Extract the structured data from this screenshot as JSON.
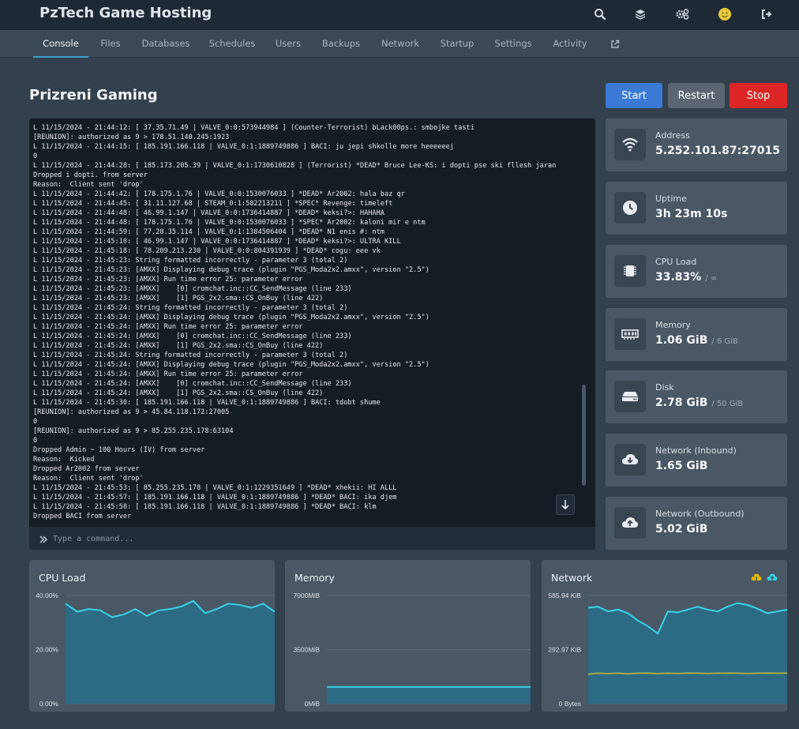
{
  "app": {
    "title": "PzTech Game Hosting"
  },
  "topbar": {
    "icons": [
      "search-icon",
      "layers-icon",
      "cogs-icon",
      "avatar",
      "logout-icon"
    ]
  },
  "nav": {
    "tabs": [
      {
        "label": "Console",
        "active": true
      },
      {
        "label": "Files"
      },
      {
        "label": "Databases"
      },
      {
        "label": "Schedules"
      },
      {
        "label": "Users"
      },
      {
        "label": "Backups"
      },
      {
        "label": "Network"
      },
      {
        "label": "Startup"
      },
      {
        "label": "Settings"
      },
      {
        "label": "Activity"
      }
    ],
    "external_icon": "external-link-icon"
  },
  "server": {
    "name": "Prizreni Gaming"
  },
  "power": {
    "start": "Start",
    "restart": "Restart",
    "stop": "Stop"
  },
  "console": {
    "lines": [
      "L 11/15/2024 - 21:44:12: [ 37.35.71.49 | VALVE_0:0:573944984 ] (Counter-Terrorist) bLack00ps.: smbojke tasti",
      "[REUNION]: authorized as 9 > 178.51.140.245:1923",
      "L 11/15/2024 - 21:44:15: [ 185.191.166.118 | VALVE_0:1:1889749886 ] BACI: ju jepi shkolle more heeeeeej",
      "0",
      "L 11/15/2024 - 21:44:28: [ 185.173.205.39 | VALVE_0:1:1730610828 ] (Terrorist) *DEAD* Bruce Lee-KS: i dopti pse ski fllesh jaran",
      "Dropped i dopti. from server",
      "Reason:  Client sent 'drop'",
      "L 11/15/2024 - 21:44:42: [ 178.175.1.76 | VALVE_0:0:1530076033 ] *DEAD* Ar2002: hala baz qr",
      "L 11/15/2024 - 21:44:45: [ 31.11.127.68 | STEAM_0:1:582213211 ] *SPEC* Revenge: timeleft",
      "L 11/15/2024 - 21:44:48: [ 46.99.1.147 | VALVE_0:0:1736414887 ] *DEAD* keksi?>: HAHAHA",
      "L 11/15/2024 - 21:44:48: [ 178.175.1.76 | VALVE_0:0:1530076033 ] *SPEC* Ar2002: kaloni mir e ntm",
      "L 11/15/2024 - 21:44:59: [ 77.28.35.114 | VALVE_0:1:1384506404 ] *DEAD* N1 enis #: ntm",
      "L 11/15/2024 - 21:45:10: [ 46.99.1.147 | VALVE_0:0:1736414887 ] *DEAD* keksi?>: ULTRA KILL",
      "L 11/15/2024 - 21:45:18: [ 78.209.213.230 | VALVE_0:0:804391939 ] *DEAD* cogu: eee vk",
      "L 11/15/2024 - 21:45:23: String formatted incorrectly - parameter 3 (total 2)",
      "L 11/15/2024 - 21:45:23: [AMXX] Displaying debug trace (plugin \"PGS_Moda2x2.amxx\", version \"2.5\")",
      "L 11/15/2024 - 21:45:23: [AMXX] Run time error 25: parameter error",
      "L 11/15/2024 - 21:45:23: [AMXX]    [0] cromchat.inc::CC_SendMessage (line 233)",
      "L 11/15/2024 - 21:45:23: [AMXX]    [1] PGS_2x2.sma::CS_OnBuy (line 422)",
      "L 11/15/2024 - 21:45:24: String formatted incorrectly - parameter 3 (total 2)",
      "L 11/15/2024 - 21:45:24: [AMXX] Displaying debug trace (plugin \"PGS_Moda2x2.amxx\", version \"2.5\")",
      "L 11/15/2024 - 21:45:24: [AMXX] Run time error 25: parameter error",
      "L 11/15/2024 - 21:45:24: [AMXX]    [0] cromchat.inc::CC_SendMessage (line 233)",
      "L 11/15/2024 - 21:45:24: [AMXX]    [1] PGS_2x2.sma::CS_OnBuy (line 422)",
      "L 11/15/2024 - 21:45:24: String formatted incorrectly - parameter 3 (total 2)",
      "L 11/15/2024 - 21:45:24: [AMXX] Displaying debug trace (plugin \"PGS_Moda2x2.amxx\", version \"2.5\")",
      "L 11/15/2024 - 21:45:24: [AMXX] Run time error 25: parameter error",
      "L 11/15/2024 - 21:45:24: [AMXX]    [0] cromchat.inc::CC_SendMessage (line 233)",
      "L 11/15/2024 - 21:45:24: [AMXX]    [1] PGS_2x2.sma::CS_OnBuy (line 422)",
      "L 11/15/2024 - 21:45:30: [ 185.191.166.118 | VALVE_0:1:1889749886 ] BACI: tdobt shume",
      "[REUNION]: authorized as 9 > 45.84.118.172:27005",
      "0",
      "[REUNION]: authorized as 9 > 85.255.235.178:63104",
      "0",
      "Dropped Admin ~ 100 Hours (IV) from server",
      "Reason:  Kicked",
      "Dropped Ar2002 from server",
      "Reason:  Client sent 'drop'",
      "L 11/15/2024 - 21:45:53: [ 85.255.235.178 | VALVE_0:1:1229351649 ] *DEAD* xhekii: HI ALLL",
      "L 11/15/2024 - 21:45:57: [ 185.191.166.118 | VALVE_0:1:1889749886 ] *DEAD* BACI: ika djem",
      "L 11/15/2024 - 21:45:58: [ 185.191.166.118 | VALVE_0:1:1889749886 ] *DEAD* BACI: klm",
      "Dropped BACI from server"
    ],
    "command_placeholder": "Type a command..."
  },
  "stats": [
    {
      "label": "Address",
      "value": "5.252.101.87:27015",
      "sub": "",
      "icon": "wifi-icon"
    },
    {
      "label": "Uptime",
      "value": "3h 23m 10s",
      "sub": "",
      "icon": "clock-icon"
    },
    {
      "label": "CPU Load",
      "value": "33.83%",
      "sub": "/ ∞",
      "icon": "cpu-chip-icon"
    },
    {
      "label": "Memory",
      "value": "1.06 GiB",
      "sub": "/ 6 GiB",
      "icon": "memory-icon"
    },
    {
      "label": "Disk",
      "value": "2.78 GiB",
      "sub": "/ 50 GiB",
      "icon": "hdd-icon"
    },
    {
      "label": "Network (Inbound)",
      "value": "1.65 GiB",
      "sub": "",
      "icon": "cloud-download-icon"
    },
    {
      "label": "Network (Outbound)",
      "value": "5.02 GiB",
      "sub": "",
      "icon": "cloud-upload-icon"
    }
  ],
  "colors": {
    "accent": "#3b9fd1",
    "start": "#3a7ad6",
    "stop": "#dc2626",
    "line": "#36d3e8",
    "area": "#2a6d86",
    "inbound": "#e6b800"
  },
  "chart_data": [
    {
      "type": "area",
      "title": "CPU Load",
      "yticks": [
        "40.00%",
        "20.00%",
        "0.00%"
      ],
      "ylim": [
        0,
        40
      ],
      "series": [
        {
          "values": [
            37,
            34,
            35,
            34.5,
            32,
            33,
            35,
            32.5,
            34.5,
            35,
            36,
            38,
            33.5,
            35,
            37,
            36.5,
            35.5,
            37,
            34
          ]
        }
      ]
    },
    {
      "type": "area",
      "title": "Memory",
      "yticks": [
        "7000MiB",
        "3500MiB",
        "0MiB"
      ],
      "ylim": [
        0,
        7000
      ],
      "series": [
        {
          "values": [
            1085,
            1085,
            1085,
            1085,
            1085,
            1085,
            1085,
            1085,
            1085,
            1085,
            1085,
            1085
          ]
        }
      ]
    },
    {
      "type": "area",
      "title": "Network",
      "yticks": [
        "585.94 KiB",
        "292.97 KiB",
        "0 Bytes"
      ],
      "ylim": [
        0,
        585.94
      ],
      "legend_icons": [
        "cloud-download-icon",
        "cloud-upload-icon"
      ],
      "series": [
        {
          "values": [
            520,
            525,
            500,
            510,
            490,
            450,
            420,
            380,
            500,
            495,
            510,
            525,
            510,
            500,
            525,
            545,
            535,
            515,
            490,
            500,
            510
          ]
        },
        {
          "values": [
            160,
            165,
            163,
            165,
            162,
            165,
            166,
            163,
            165,
            164,
            166,
            165,
            164,
            165,
            166,
            165,
            164,
            165,
            166,
            165,
            166
          ]
        }
      ]
    }
  ]
}
